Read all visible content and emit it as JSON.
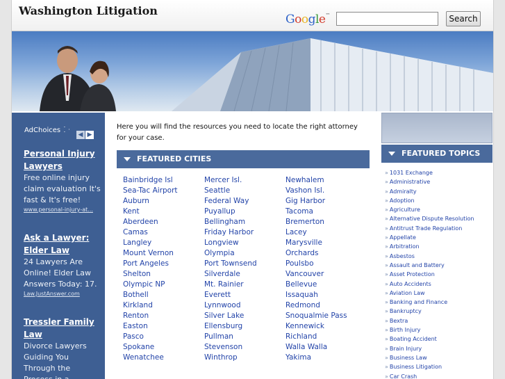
{
  "header": {
    "site_title": "Washington Litigation",
    "google_letters": [
      "G",
      "o",
      "o",
      "g",
      "l",
      "e"
    ],
    "google_tm": "™",
    "search_placeholder": "",
    "search_button": "Search"
  },
  "ads": {
    "adchoices_label": "AdChoices",
    "prev_icon": "◀",
    "next_icon": "▶",
    "items": [
      {
        "title": "Personal Injury Lawyers",
        "text": "Free online injury claim evaluation It's fast & It's free!",
        "url": "www.personal-injury-at..."
      },
      {
        "title": "Ask a Lawyer: Elder Law",
        "text": "24 Lawyers Are Online! Elder Law Answers Today: 17.",
        "url": "Law.JustAnswer.com"
      },
      {
        "title": "Tressler Family Law",
        "text": "Divorce Lawyers Guiding You Through the Process in a",
        "url": ""
      }
    ]
  },
  "main": {
    "intro": "Here you will find the resources you need to locate the right attorney for your case.",
    "featured_cities_title": "FEATURED CITIES",
    "city_columns": [
      [
        "Bainbridge Isl",
        "Sea-Tac Airport",
        "Auburn",
        "Kent",
        "Aberdeen",
        "Camas",
        "Langley",
        "Mount Vernon",
        "Port Angeles",
        "Shelton",
        "Olympic NP",
        "Bothell",
        "Kirkland",
        "Renton",
        "Easton",
        "Pasco",
        "Spokane",
        "Wenatchee"
      ],
      [
        "Mercer Isl.",
        "Seattle",
        "Federal Way",
        "Puyallup",
        "Bellingham",
        "Friday Harbor",
        "Longview",
        "Olympia",
        "Port Townsend",
        "Silverdale",
        "Mt. Rainier",
        "Everett",
        "Lynnwood",
        "Silver Lake",
        "Ellensburg",
        "Pullman",
        "Stevenson",
        "Winthrop"
      ],
      [
        "Newhalem",
        "Vashon Isl.",
        "Gig Harbor",
        "Tacoma",
        "Bremerton",
        "Lacey",
        "Marysville",
        "Orchards",
        "Poulsbo",
        "Vancouver",
        "Bellevue",
        "Issaquah",
        "Redmond",
        "Snoqualmie Pass",
        "Kennewick",
        "Richland",
        "Walla Walla",
        "Yakima"
      ]
    ]
  },
  "sidebar_right": {
    "featured_topics_title": "FEATURED TOPICS",
    "bullet": "»",
    "topics": [
      "1031 Exchange",
      "Administrative",
      "Admiralty",
      "Adoption",
      "Agriculture",
      "Alternative Dispute Resolution",
      "Antitrust Trade Regulation",
      "Appellate",
      "Arbitration",
      "Asbestos",
      "Assault and Battery",
      "Asset Protection",
      "Auto Accidents",
      "Aviation Law",
      "Banking and Finance",
      "Bankruptcy",
      "Bextra",
      "Birth Injury",
      "Boating Accident",
      "Brain Injury",
      "Business Law",
      "Business Litigation",
      "Car Crash"
    ]
  },
  "colors": {
    "nav_blue": "#4a6a9c",
    "ad_column": "#3e5f93",
    "link_blue": "#2243a8"
  }
}
